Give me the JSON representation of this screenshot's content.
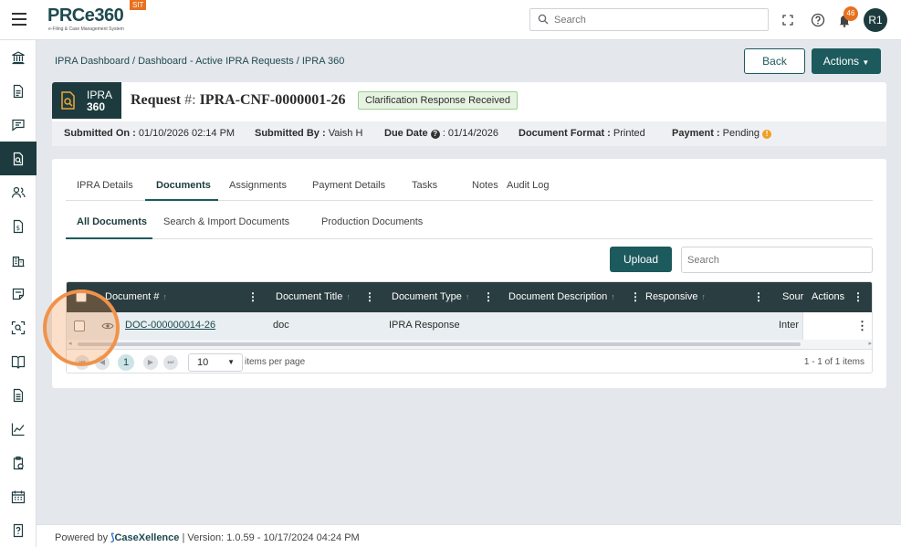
{
  "app": {
    "logo_text": "PRCe360",
    "logo_subtitle": "e-Filing & Case Management System",
    "env_badge": "SIT",
    "search_placeholder": "Search",
    "notification_count": "46",
    "user_initials": "R1"
  },
  "sidebar": {
    "items": [
      {
        "icon": "bank-icon"
      },
      {
        "icon": "document-icon"
      },
      {
        "icon": "chat-icon"
      },
      {
        "icon": "document-search-icon",
        "active": true
      },
      {
        "icon": "users-icon"
      },
      {
        "icon": "dollar-document-icon"
      },
      {
        "icon": "building-icon"
      },
      {
        "icon": "edit-note-icon"
      },
      {
        "icon": "scan-search-icon"
      },
      {
        "icon": "book-icon"
      },
      {
        "icon": "file-lines-icon"
      },
      {
        "icon": "chart-icon"
      },
      {
        "icon": "clipboard-icon"
      },
      {
        "icon": "calendar-icon"
      },
      {
        "icon": "help-document-icon"
      }
    ]
  },
  "breadcrumb": {
    "text": "IPRA Dashboard / Dashboard - Active IPRA Requests / IPRA 360"
  },
  "header_buttons": {
    "back": "Back",
    "actions": "Actions"
  },
  "request": {
    "badge_line1": "IPRA",
    "badge_line2": "360",
    "title_prefix": "Request",
    "title_hash": "#:",
    "request_id": "IPRA-CNF-0000001-26",
    "status": "Clarification Response Received",
    "meta": {
      "submitted_on_label": "Submitted On :",
      "submitted_on": "01/10/2026 02:14 PM",
      "submitted_by_label": "Submitted By :",
      "submitted_by": "Vaish H",
      "due_date_label": "Due Date",
      "due_date": ": 01/14/2026",
      "format_label": "Document Format :",
      "format": "Printed",
      "payment_label": "Payment :",
      "payment": "Pending"
    }
  },
  "tabs": [
    "IPRA Details",
    "Documents",
    "Assignments",
    "Payment Details",
    "Tasks",
    "Notes",
    "Audit Log"
  ],
  "subtabs": [
    "All Documents",
    "Search & Import Documents",
    "Production Documents"
  ],
  "toolbar": {
    "upload": "Upload",
    "search_placeholder": "Search"
  },
  "grid": {
    "columns": [
      "Document #",
      "Document Title",
      "Document Type",
      "Document Description",
      "Responsive",
      "Sour",
      "Actions"
    ],
    "rows": [
      {
        "doc_number": "DOC-000000014-26",
        "title": "doc",
        "type": "IPRA Response",
        "description": "",
        "responsive": "",
        "source": "Inter"
      }
    ],
    "pager": {
      "current_page": "1",
      "page_size": "10",
      "page_size_label": "items per page",
      "info": "1 - 1 of 1 items"
    }
  },
  "footer": {
    "powered_by": "Powered by",
    "brand": "CaseXellence",
    "version": "|  Version: 1.0.59 - 10/17/2024 04:24 PM"
  },
  "colors": {
    "primary": "#1d5a5e",
    "dark": "#1d3b3e",
    "accent_orange": "#e8701e",
    "status_green_bg": "#e6f3e2"
  }
}
